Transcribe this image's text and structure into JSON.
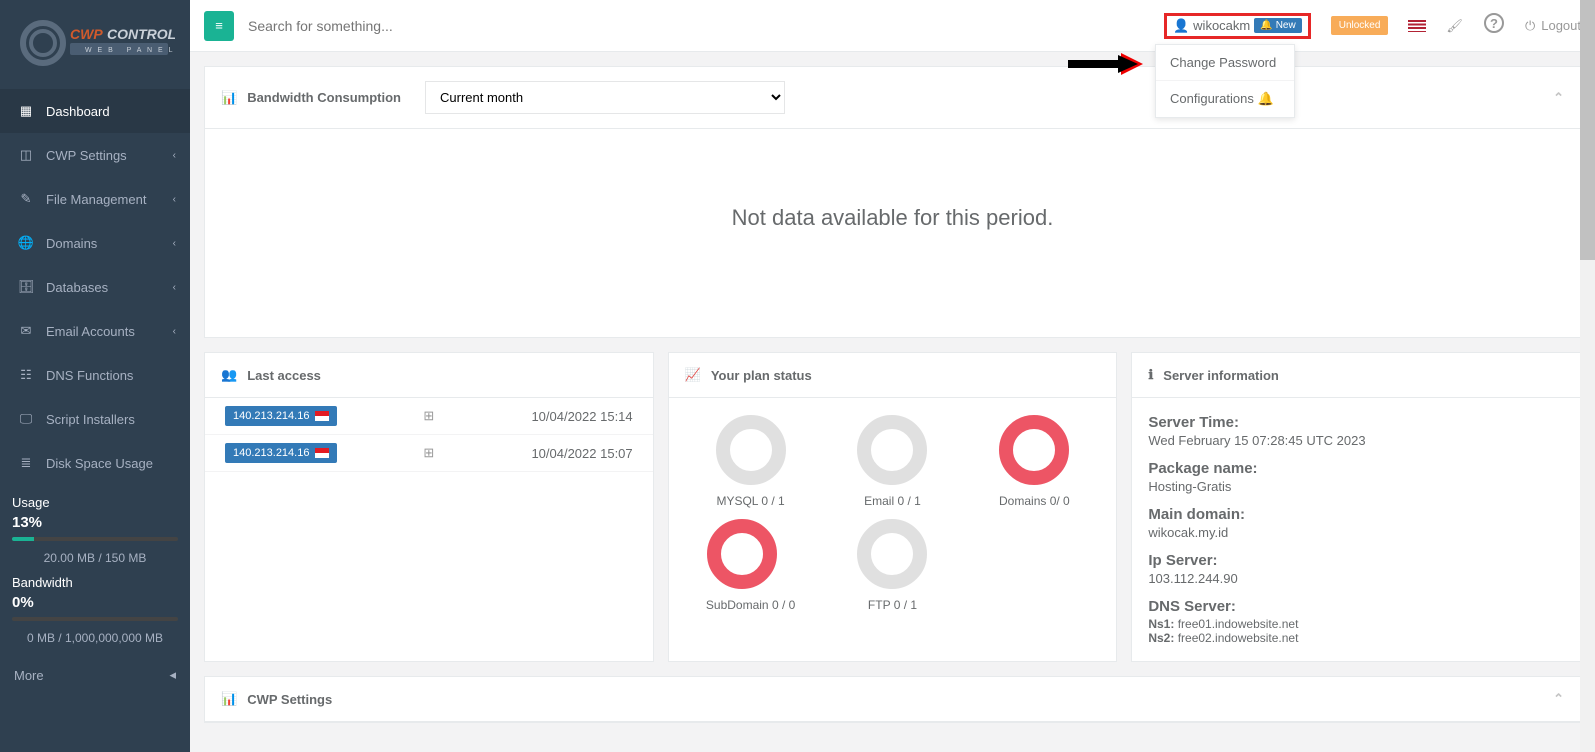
{
  "search": {
    "placeholder": "Search for something..."
  },
  "sidebar": {
    "items": [
      {
        "label": "Dashboard",
        "active": true
      },
      {
        "label": "CWP Settings"
      },
      {
        "label": "File Management"
      },
      {
        "label": "Domains"
      },
      {
        "label": "Databases"
      },
      {
        "label": "Email Accounts"
      },
      {
        "label": "DNS Functions"
      },
      {
        "label": "Script Installers"
      },
      {
        "label": "Disk Space Usage"
      }
    ]
  },
  "usage": {
    "usage_label": "Usage",
    "usage_pct": "13%",
    "usage_text": "20.00 MB / 150 MB",
    "bw_label": "Bandwidth",
    "bw_pct": "0%",
    "bw_text": "0 MB / 1,000,000,000 MB",
    "more_label": "More"
  },
  "user": {
    "name": "wikocakm",
    "badge_new": "New",
    "unlocked": "Unlocked",
    "logout": "Logout",
    "dropdown": {
      "change_password": "Change Password",
      "configurations": "Configurations"
    }
  },
  "bandwidth_panel": {
    "title": "Bandwidth Consumption",
    "period": "Current month",
    "nodata": "Not data available for this period."
  },
  "last_access": {
    "title": "Last access",
    "rows": [
      {
        "ip": "140.213.214.16",
        "date": "10/04/2022 15:14"
      },
      {
        "ip": "140.213.214.16",
        "date": "10/04/2022 15:07"
      }
    ]
  },
  "plan_status": {
    "title": "Your plan status",
    "items": [
      {
        "label": "MYSQL 0 / 1",
        "pct": 0
      },
      {
        "label": "Email 0 / 1",
        "pct": 0
      },
      {
        "label": "Domains 0/ 0",
        "pct": 100
      },
      {
        "label": "SubDomain 0 / 0",
        "pct": 100
      },
      {
        "label": "FTP 0 / 1",
        "pct": 0
      }
    ]
  },
  "server_info": {
    "title": "Server information",
    "time_label": "Server Time:",
    "time_val": "Wed February 15 07:28:45 UTC 2023",
    "pkg_label": "Package name:",
    "pkg_val": "Hosting-Gratis",
    "domain_label": "Main domain:",
    "domain_val": "wikocak.my.id",
    "ip_label": "Ip Server:",
    "ip_val": "103.112.244.90",
    "dns_label": "DNS Server:",
    "ns1_label": "Ns1:",
    "ns1_val": "free01.indowebsite.net",
    "ns2_label": "Ns2:",
    "ns2_val": "free02.indowebsite.net"
  },
  "cwp_settings_panel": {
    "title": "CWP Settings"
  }
}
